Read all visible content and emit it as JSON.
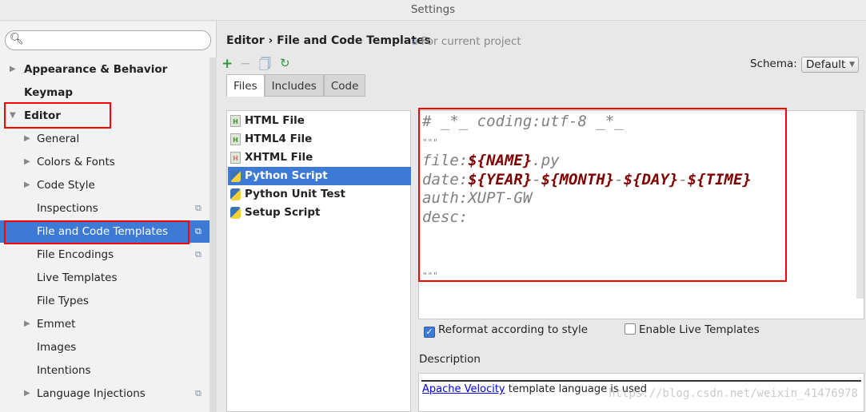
{
  "window": {
    "title": "Settings"
  },
  "sidebar": {
    "search_placeholder": "",
    "items": [
      {
        "label": "Appearance & Behavior",
        "level": 0,
        "arrow": "right"
      },
      {
        "label": "Keymap",
        "level": 0,
        "arrow": ""
      },
      {
        "label": "Editor",
        "level": 0,
        "arrow": "down"
      },
      {
        "label": "General",
        "level": 1,
        "arrow": "right"
      },
      {
        "label": "Colors & Fonts",
        "level": 1,
        "arrow": "right"
      },
      {
        "label": "Code Style",
        "level": 1,
        "arrow": "right"
      },
      {
        "label": "Inspections",
        "level": 1,
        "arrow": "",
        "copy": true
      },
      {
        "label": "File and Code Templates",
        "level": 1,
        "arrow": "",
        "copy": true,
        "selected": true
      },
      {
        "label": "File Encodings",
        "level": 1,
        "arrow": "",
        "copy": true
      },
      {
        "label": "Live Templates",
        "level": 1,
        "arrow": ""
      },
      {
        "label": "File Types",
        "level": 1,
        "arrow": ""
      },
      {
        "label": "Emmet",
        "level": 1,
        "arrow": "right"
      },
      {
        "label": "Images",
        "level": 1,
        "arrow": ""
      },
      {
        "label": "Intentions",
        "level": 1,
        "arrow": ""
      },
      {
        "label": "Language Injections",
        "level": 1,
        "arrow": "right",
        "copy": true
      }
    ]
  },
  "main": {
    "breadcrumb": "Editor › File and Code Templates",
    "scope": "For current project",
    "schema_label": "Schema:",
    "schema_value": "Default",
    "tabs": [
      {
        "label": "Files",
        "active": true
      },
      {
        "label": "Includes"
      },
      {
        "label": "Code"
      }
    ],
    "files": [
      {
        "label": "HTML File",
        "icon": "html-file-icon"
      },
      {
        "label": "HTML4 File",
        "icon": "html-file-icon"
      },
      {
        "label": "XHTML File",
        "icon": "xhtml-file-icon"
      },
      {
        "label": "Python Script",
        "icon": "python-icon",
        "selected": true
      },
      {
        "label": "Python Unit Test",
        "icon": "python-icon"
      },
      {
        "label": "Setup Script",
        "icon": "python-icon"
      }
    ],
    "code": {
      "l1": "# _*_ coding:utf-8 _*_",
      "l2": "\"\"\"",
      "file_k": "file:",
      "file_v": "${NAME}",
      "file_s": ".py",
      "date_k": "date:",
      "y": "${YEAR}",
      "m": "${MONTH}",
      "d": "${DAY}",
      "t": "${TIME}",
      "dash": "-",
      "auth": "auth:XUPT-GW",
      "desc": "desc:",
      "l9": "\"\"\""
    },
    "reformat_label": "Reformat according to style",
    "reformat_checked": true,
    "live_label": "Enable Live Templates",
    "live_checked": false,
    "description_label": "Description",
    "desc_link": "Apache Velocity",
    "desc_text": " template language is used",
    "watermark": "https://blog.csdn.net/weixin_41476978"
  },
  "colors": {
    "accent": "#3d7ad6",
    "highlight_box": "#ff0000",
    "variable": "#7f0000"
  }
}
